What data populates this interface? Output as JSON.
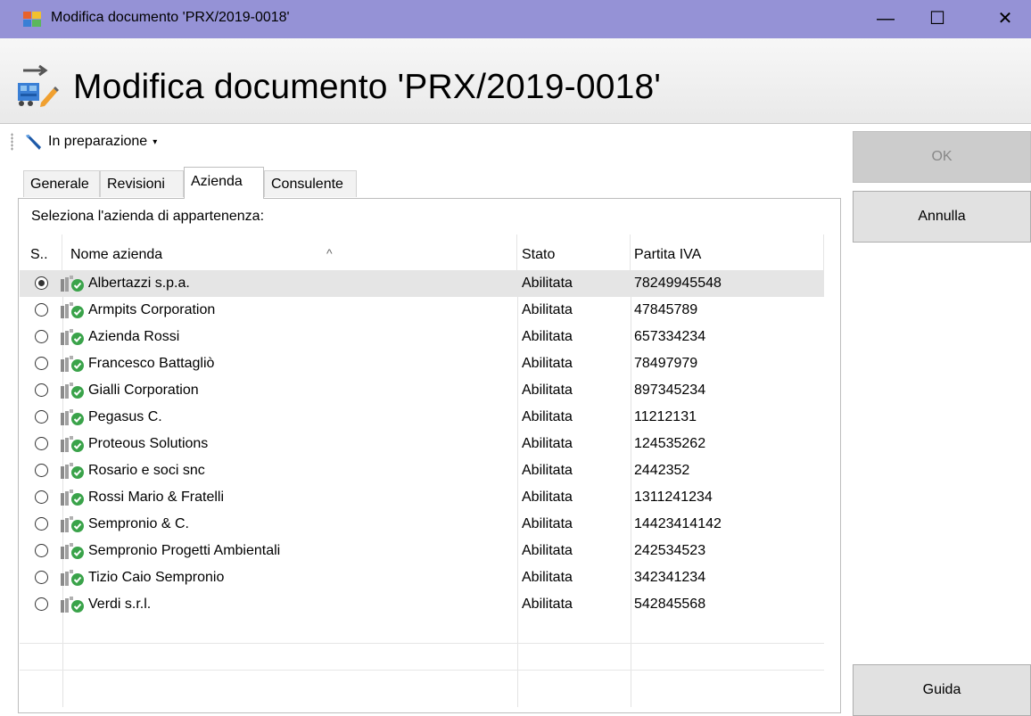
{
  "window": {
    "title": "Modifica documento 'PRX/2019-0018'",
    "minimize": "—",
    "maximize": "☐",
    "close": "✕"
  },
  "header": {
    "title": "Modifica documento 'PRX/2019-0018'"
  },
  "status": {
    "label": "In preparazione",
    "caret": "▾"
  },
  "tabs": [
    {
      "label": "Generale"
    },
    {
      "label": "Revisioni"
    },
    {
      "label": "Azienda",
      "active": true
    },
    {
      "label": "Consulente"
    }
  ],
  "panel": {
    "prompt": "Seleziona l'azienda di appartenenza:",
    "columns": {
      "sel": "S..",
      "name": "Nome azienda",
      "stato": "Stato",
      "iva": "Partita IVA",
      "sort_indicator": "^"
    },
    "rows": [
      {
        "name": "Albertazzi s.p.a.",
        "stato": "Abilitata",
        "iva": "78249945548",
        "selected": true
      },
      {
        "name": "Armpits Corporation",
        "stato": "Abilitata",
        "iva": "47845789"
      },
      {
        "name": "Azienda Rossi",
        "stato": "Abilitata",
        "iva": "657334234"
      },
      {
        "name": "Francesco Battagliò",
        "stato": "Abilitata",
        "iva": "78497979"
      },
      {
        "name": "Gialli Corporation",
        "stato": "Abilitata",
        "iva": "897345234"
      },
      {
        "name": "Pegasus C.",
        "stato": "Abilitata",
        "iva": "11212131"
      },
      {
        "name": "Proteous Solutions",
        "stato": "Abilitata",
        "iva": "124535262"
      },
      {
        "name": "Rosario e soci snc",
        "stato": "Abilitata",
        "iva": "2442352"
      },
      {
        "name": "Rossi Mario & Fratelli",
        "stato": "Abilitata",
        "iva": "1311241234"
      },
      {
        "name": "Sempronio & C.",
        "stato": "Abilitata",
        "iva": "14423414142"
      },
      {
        "name": "Sempronio Progetti Ambientali",
        "stato": "Abilitata",
        "iva": "242534523"
      },
      {
        "name": "Tizio Caio Sempronio",
        "stato": "Abilitata",
        "iva": "342341234"
      },
      {
        "name": "Verdi s.r.l.",
        "stato": "Abilitata",
        "iva": "542845568"
      }
    ]
  },
  "buttons": {
    "ok": "OK",
    "cancel": "Annulla",
    "help": "Guida"
  },
  "colors": {
    "titlebar": "#9592d6",
    "selected_row": "#e5e5e5",
    "status_green": "#3aa34a"
  }
}
